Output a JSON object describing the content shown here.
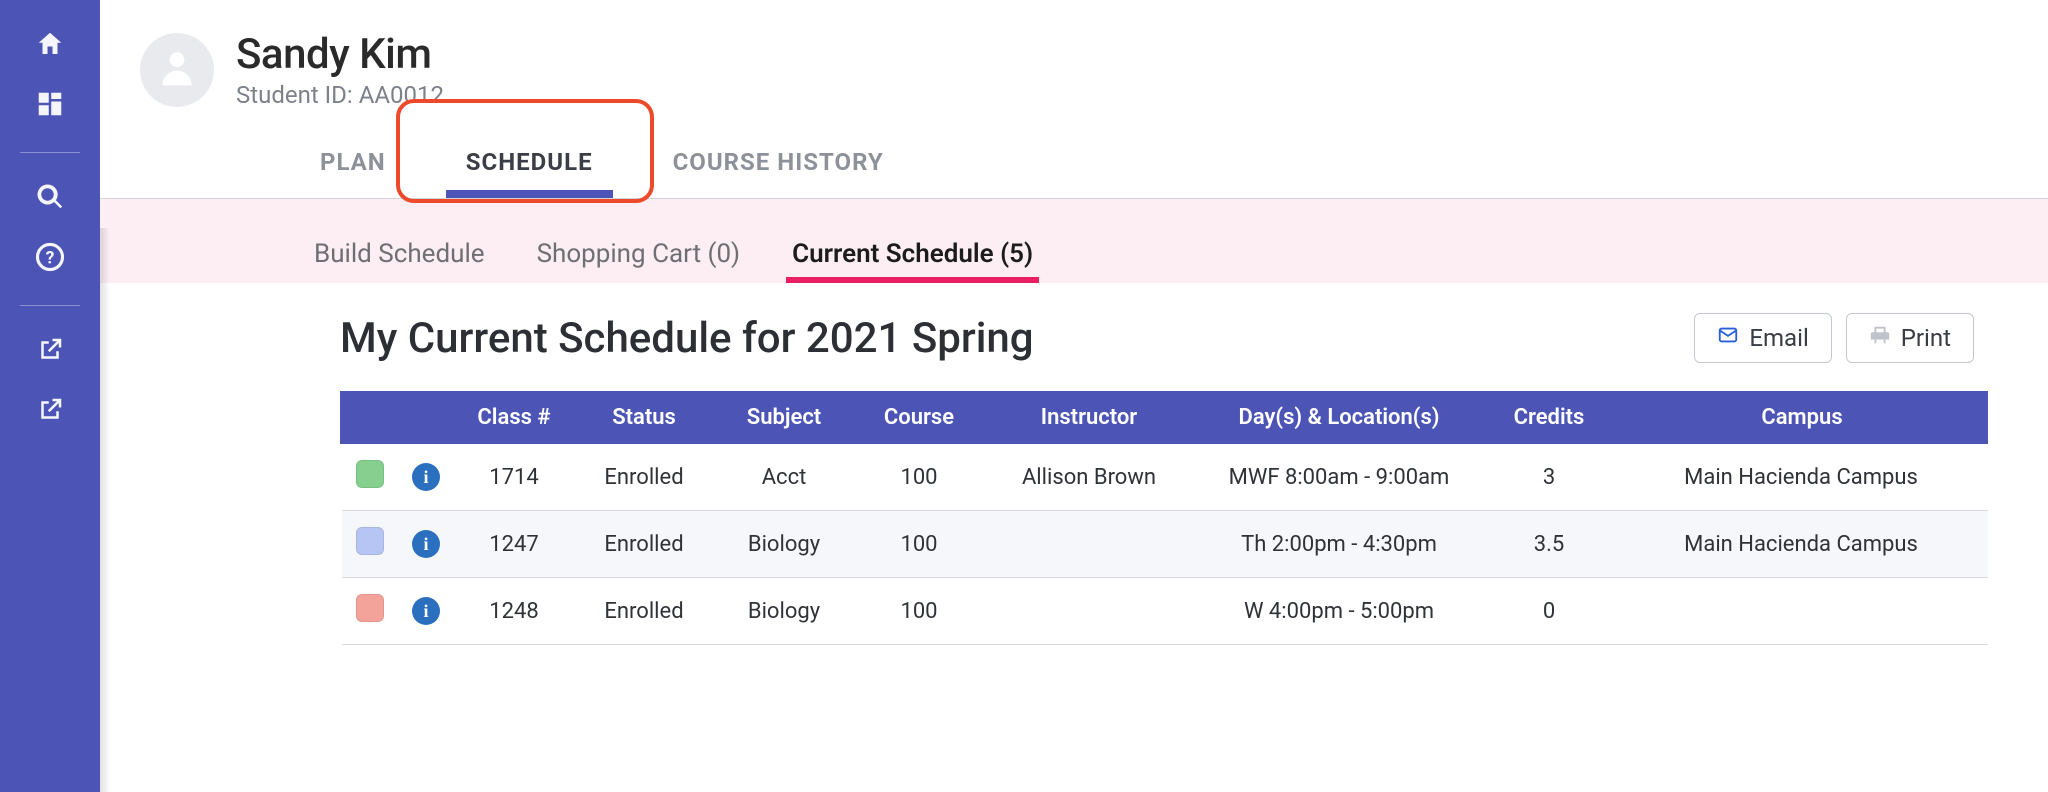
{
  "sidebar": {
    "items": [
      {
        "name": "home-icon"
      },
      {
        "name": "dashboard-icon"
      },
      {
        "name": "search-icon"
      },
      {
        "name": "help-icon"
      },
      {
        "name": "external-link-icon"
      },
      {
        "name": "external-link-icon-2"
      }
    ]
  },
  "header": {
    "student_name": "Sandy Kim",
    "student_id": "Student ID: AA0012"
  },
  "primary_tabs": {
    "plan": "PLAN",
    "schedule": "SCHEDULE",
    "course_history": "COURSE HISTORY",
    "active": "schedule"
  },
  "secondary_tabs": {
    "build": "Build Schedule",
    "cart": "Shopping Cart (0)",
    "current": "Current Schedule (5)",
    "active": "current"
  },
  "page_title": "My Current Schedule for 2021 Spring",
  "actions": {
    "email": "Email",
    "print": "Print"
  },
  "table": {
    "headers": {
      "class_no": "Class #",
      "status": "Status",
      "subject": "Subject",
      "course": "Course",
      "instructor": "Instructor",
      "day_loc": "Day(s) & Location(s)",
      "credits": "Credits",
      "campus": "Campus"
    },
    "rows": [
      {
        "swatch_color": "#86cf8e",
        "class_no": "1714",
        "status": "Enrolled",
        "subject": "Acct",
        "course": "100",
        "instructor": "Allison Brown",
        "day_loc": "MWF 8:00am - 9:00am",
        "credits": "3",
        "campus": "Main Hacienda Campus"
      },
      {
        "swatch_color": "#b6c5f4",
        "class_no": "1247",
        "status": "Enrolled",
        "subject": "Biology",
        "course": "100",
        "instructor": "",
        "day_loc": "Th 2:00pm - 4:30pm",
        "credits": "3.5",
        "campus": "Main Hacienda Campus"
      },
      {
        "swatch_color": "#f3a399",
        "class_no": "1248",
        "status": "Enrolled",
        "subject": "Biology",
        "course": "100",
        "instructor": "",
        "day_loc": "W 4:00pm - 5:00pm",
        "credits": "0",
        "campus": ""
      }
    ]
  }
}
